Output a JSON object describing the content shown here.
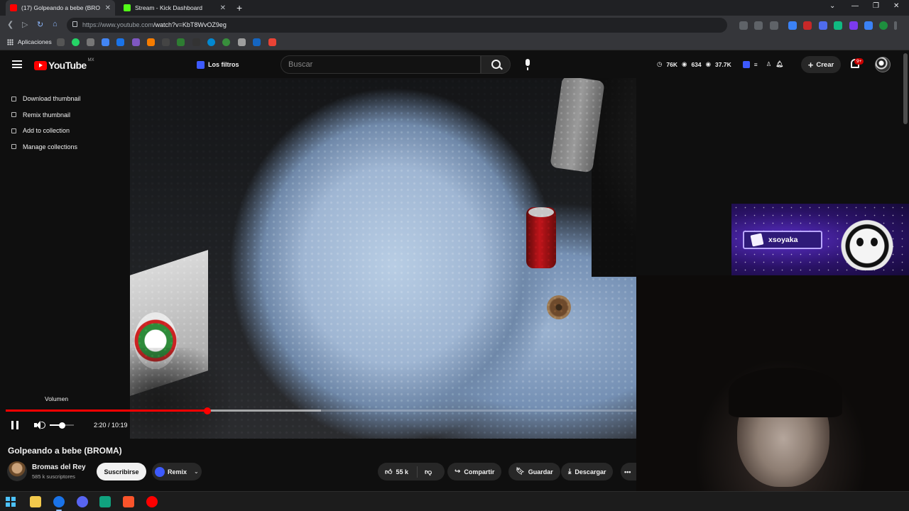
{
  "browser": {
    "tabs": [
      {
        "title": "(17) Golpeando a bebe (BRO",
        "favicon_color": "#ff0000",
        "active": true
      },
      {
        "title": "Stream - Kick Dashboard",
        "favicon_color": "#53fc18",
        "active": false
      }
    ],
    "new_tab_label": "+",
    "url_domain": "https://www.youtube.com",
    "url_path": "/watch?v=KbT8WvOZ9eg",
    "bookmarks_label": "Aplicaciones"
  },
  "youtube": {
    "logo_text": "YouTube",
    "country_code": "MX",
    "filters_label": "Los filtros",
    "search_placeholder": "Buscar",
    "stats": [
      "76K",
      "634",
      "37.7K"
    ],
    "create_label": "Crear",
    "notifications_badge": "9+"
  },
  "context_menu": [
    {
      "label": "Download thumbnail",
      "icon": "download-icon"
    },
    {
      "label": "Remix thumbnail",
      "icon": "remix-icon"
    },
    {
      "label": "Add to collection",
      "icon": "collection-add-icon"
    },
    {
      "label": "Manage collections",
      "icon": "collections-icon"
    }
  ],
  "player": {
    "tooltip": "Volumen",
    "current_time": "2:20",
    "duration": "10:19",
    "time_display": "2:20 / 10:19",
    "played_fraction": 0.32,
    "buffered_fraction": 0.5,
    "volume_fraction": 0.5
  },
  "video": {
    "title": "Golpeando a bebe (BROMA)",
    "channel_name": "Bromas del Rey",
    "subscribers": "585 k suscriptores",
    "subscribe_label": "Suscribirse",
    "remix_label": "Remix",
    "likes": "55 k",
    "share_label": "Compartir",
    "save_label": "Guardar",
    "download_label": "Descargar"
  },
  "overlay": {
    "kick_username": "xsoyaka"
  },
  "colors": {
    "accent_red": "#ff0000",
    "kick_purple": "#5a2fc8",
    "background": "#0f0f0f"
  }
}
